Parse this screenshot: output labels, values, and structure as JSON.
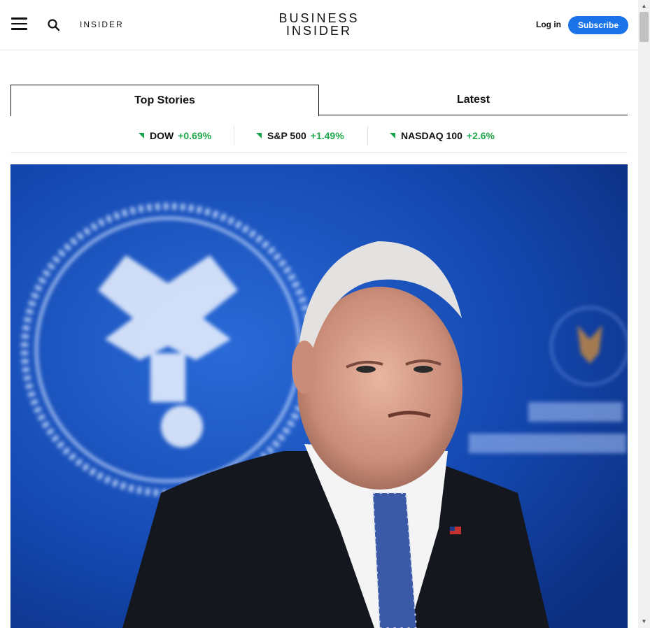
{
  "header": {
    "insider_label": "INSIDER",
    "logo_line1": "BUSINESS",
    "logo_line2": "INSIDER",
    "login_label": "Log in",
    "subscribe_label": "Subscribe"
  },
  "tabs": [
    {
      "label": "Top Stories",
      "active": true
    },
    {
      "label": "Latest",
      "active": false
    }
  ],
  "ticker": [
    {
      "name": "DOW",
      "change": "+0.69%",
      "direction": "up"
    },
    {
      "name": "S&P 500",
      "change": "+1.49%",
      "direction": "up"
    },
    {
      "name": "NASDAQ 100",
      "change": "+2.6%",
      "direction": "up"
    }
  ],
  "colors": {
    "accent": "#1a73e8",
    "positive": "#1fa84c",
    "hero_background": "#1447a8"
  }
}
